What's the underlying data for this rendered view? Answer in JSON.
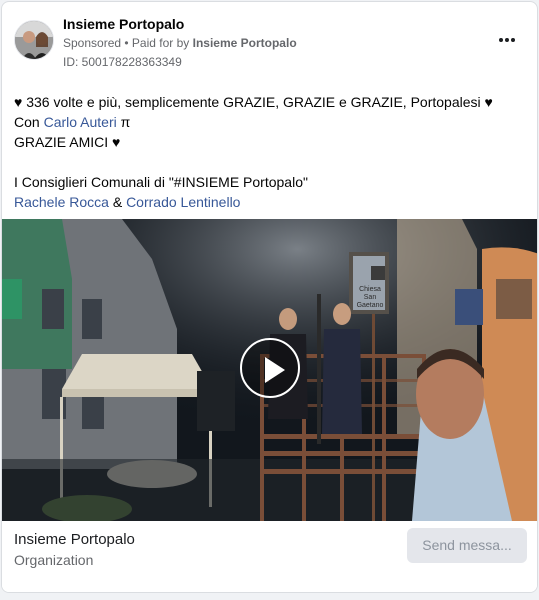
{
  "header": {
    "page_name": "Insieme Portopalo",
    "sponsored": "Sponsored",
    "paid_prefix": " • Paid for by ",
    "paid_by": "Insieme Portopalo",
    "id_text": "ID: 500178228363349",
    "more_icon": "ellipsis-icon"
  },
  "post": {
    "line1": "♥ 336 volte e più, semplicemente GRAZIE, GRAZIE e GRAZIE, Portopalesi ♥",
    "line2_prefix": "Con ",
    "line2_link": "Carlo Auteri",
    "line2_suffix": " π",
    "line3": "GRAZIE AMICI ♥",
    "line4": "I Consiglieri Comunali di \"#INSIEME Portopalo\"",
    "line5_link1": "Rachele Rocca",
    "line5_sep": " & ",
    "line5_link2": "Corrado Lentinello"
  },
  "media": {
    "type": "video",
    "sign_line1": "Chiesa",
    "sign_line2": "San",
    "sign_line3": "Gaetano",
    "play_icon": "play-icon"
  },
  "footer": {
    "org_name": "Insieme Portopalo",
    "org_type": "Organization",
    "cta_label": "Send messa..."
  },
  "colors": {
    "link": "#385898",
    "secondary_text": "#65676b",
    "cta_background": "#e4e6eb"
  }
}
